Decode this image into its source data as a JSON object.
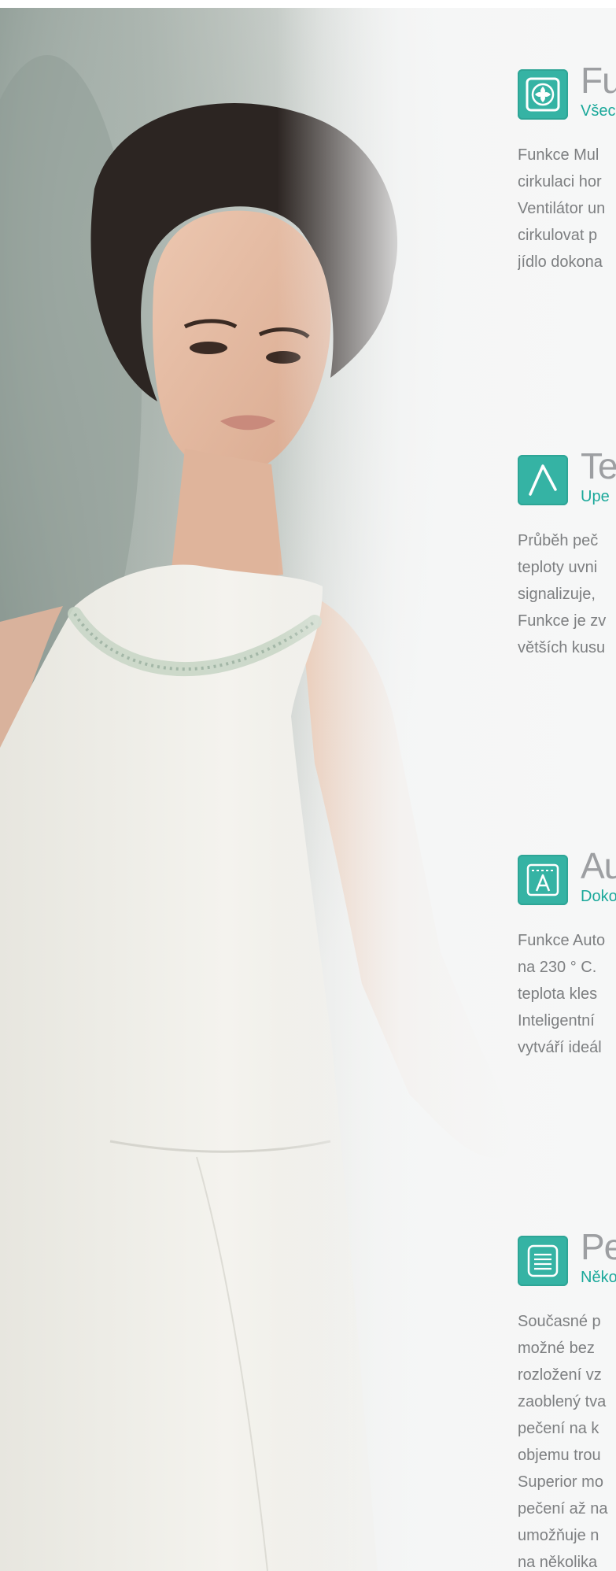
{
  "hero_image": {
    "subject": "woman-in-white-dress"
  },
  "features": [
    {
      "icon": "fan-circulation-icon",
      "title": "Fu",
      "subtitle": "Všec",
      "lines": [
        "Funkce Mul",
        "cirkulaci hor",
        "Ventilátor un",
        "cirkulovat p",
        "jídlo dokona"
      ]
    },
    {
      "icon": "temperature-curve-icon",
      "title": "Tep",
      "subtitle": "Upe",
      "lines": [
        "Průběh peč",
        "teploty uvni",
        "signalizuje,",
        "Funkce je zv",
        "větších kusu"
      ]
    },
    {
      "icon": "auto-roast-icon",
      "title": "Au",
      "subtitle": "Doko",
      "lines": [
        "Funkce Auto",
        "na 230 ° C.",
        "teplota kles",
        "Inteligentní",
        "vytváří ideál"
      ]
    },
    {
      "icon": "multi-level-baking-icon",
      "title": "Pe",
      "subtitle": "Něko",
      "lines": [
        "Současné p",
        "možné bez",
        "rozložení vz",
        "zaoblený tva",
        "pečení na k",
        "objemu trou",
        "Superior mo",
        "pečení až na",
        "umožňuje n",
        "na několika"
      ]
    }
  ],
  "colors": {
    "accent": "#1aa89a",
    "icon_bg": "#35b3a4",
    "title": "#9d9fa2",
    "body": "#7d7f81"
  }
}
